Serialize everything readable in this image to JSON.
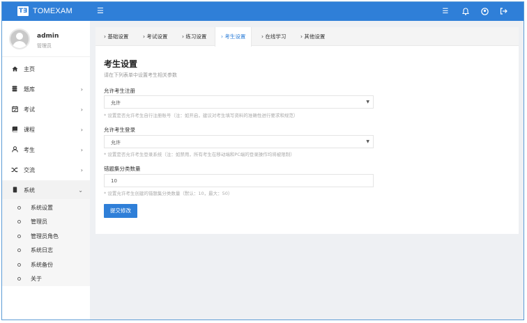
{
  "brand": {
    "mark": "T∃",
    "name": "TOMEXAM"
  },
  "topbar": {
    "icons": [
      "menu-icon",
      "list-icon",
      "bell-icon",
      "user-circle-icon",
      "logout-icon"
    ]
  },
  "user": {
    "name": "admin",
    "role": "管理员"
  },
  "sidebar": {
    "items": [
      {
        "label": "主页",
        "icon": "home-icon",
        "arrow": ""
      },
      {
        "label": "题库",
        "icon": "database-icon",
        "arrow": "›"
      },
      {
        "label": "考试",
        "icon": "calendar-icon",
        "arrow": "›"
      },
      {
        "label": "课程",
        "icon": "book-icon",
        "arrow": "›"
      },
      {
        "label": "考生",
        "icon": "user-icon",
        "arrow": "›"
      },
      {
        "label": "交流",
        "icon": "shuffle-icon",
        "arrow": "›"
      },
      {
        "label": "系统",
        "icon": "system-icon",
        "arrow": "⌄"
      }
    ],
    "sub_items": [
      "系统设置",
      "管理员",
      "管理员角色",
      "系统日志",
      "系统备份",
      "关于"
    ]
  },
  "tabs": [
    "› 基础设置",
    "› 考试设置",
    "› 练习设置",
    "› 考生设置",
    "› 在线学习",
    "› 其他设置"
  ],
  "active_tab": 3,
  "page": {
    "title": "考生设置",
    "description": "请在下列表单中设置考生相关参数"
  },
  "fields": [
    {
      "label": "允许考生注册",
      "value": "允许",
      "type": "select",
      "help": "* 设置是否允许考生自行注册账号（注：如开启，建议对考生填写资料的准确性进行要求和规范）"
    },
    {
      "label": "允许考生登录",
      "value": "允许",
      "type": "select",
      "help": "* 设置是否允许考生登录系统（注：如禁用，所有考生在移动端和PC端的登录操作均将被限制）"
    },
    {
      "label": "错题集分类数量",
      "value": "10",
      "type": "input",
      "help": "* 设置允许考生创建的错题集分类数量（默认：10，最大：50）"
    }
  ],
  "submit_label": "提交修改",
  "colors": {
    "primary": "#2f7fd8",
    "background": "#eef0f3"
  }
}
